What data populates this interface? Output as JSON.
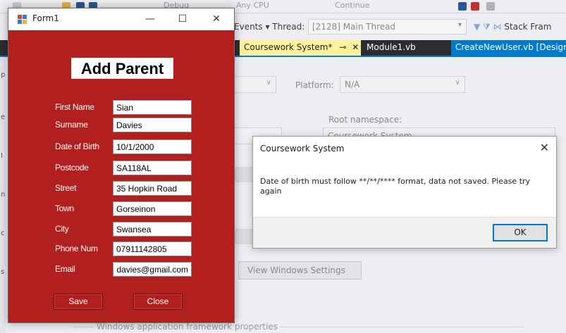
{
  "vs": {
    "toolbar": {
      "debug": "Debug",
      "any_cpu": "Any CPU",
      "continue": "Continue"
    },
    "debugbar": {
      "events_label": "Events",
      "thread_label": "Thread:",
      "thread_value": "[2128] Main Thread",
      "stack_frame": "Stack Fram"
    },
    "tabs": [
      {
        "label": "Coursework System*"
      },
      {
        "label": "Module1.vb"
      },
      {
        "label": "CreateNewUser.vb [Design]"
      }
    ],
    "tab_pin": "⊸",
    "tab_close": "✕",
    "content": {
      "platform_label": "Platform:",
      "platform_value": "N/A",
      "root_namespace_label": "Root namespace:",
      "root_namespace_value": "Coursework System",
      "view_windows_settings": "View Windows Settings",
      "app_framework_group": "Windows application framework properties"
    }
  },
  "form1": {
    "title": "Form1",
    "minimize": "—",
    "maximize": "☐",
    "close": "✕",
    "heading": "Add Parent",
    "fields": [
      {
        "label": "First Name",
        "value": "Sian"
      },
      {
        "label": "Surname",
        "value": "Davies"
      },
      {
        "label": "Date of Birth",
        "value": "10/1/2000"
      },
      {
        "label": "Postcode",
        "value": "SA118AL"
      },
      {
        "label": "Street",
        "value": "35 Hopkin Road"
      },
      {
        "label": "Town",
        "value": "Gorseinon"
      },
      {
        "label": "City",
        "value": "Swansea"
      },
      {
        "label": "Phone Num",
        "value": "07911142805"
      },
      {
        "label": "Email",
        "value": "ndavies@gmail.com"
      }
    ],
    "save_label": "Save",
    "close_label": "Close",
    "colors": {
      "form_bg": "#b21f1f"
    }
  },
  "messagebox": {
    "title": "Coursework System",
    "close": "✕",
    "message": "Date of birth must follow **/**/**** format, data not saved. Please try again",
    "ok_label": "OK"
  }
}
